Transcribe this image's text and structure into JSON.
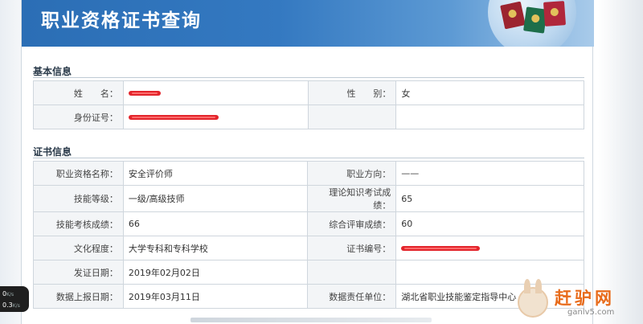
{
  "banner": {
    "title": "职业资格证书查询"
  },
  "basic": {
    "title": "基本信息",
    "rows": [
      {
        "l1": "姓　　名：",
        "v1": "",
        "l2": "性　　别：",
        "v2": "女"
      },
      {
        "l1": "身份证号：",
        "v1": "",
        "l2": "",
        "v2": ""
      }
    ]
  },
  "cert": {
    "title": "证书信息",
    "rows": [
      {
        "l1": "职业资格名称：",
        "v1": "安全评价师",
        "l2": "职业方向：",
        "v2": "——"
      },
      {
        "l1": "技能等级：",
        "v1": "一级/高级技师",
        "l2": "理论知识考试成绩：",
        "v2": "65"
      },
      {
        "l1": "技能考核成绩：",
        "v1": "66",
        "l2": "综合评审成绩：",
        "v2": "60"
      },
      {
        "l1": "文化程度：",
        "v1": "大学专科和专科学校",
        "l2": "证书编号：",
        "v2": ""
      },
      {
        "l1": "发证日期：",
        "v1": "2019年02月02日",
        "l2": "",
        "v2": ""
      },
      {
        "l1": "数据上报日期：",
        "v1": "2019年03月11日",
        "l2": "数据责任单位：",
        "v2": "湖北省职业技能鉴定指导中心"
      }
    ]
  },
  "network_widget": {
    "down_value": "0",
    "down_unit": "K/s",
    "up_value": "0.3",
    "up_unit": "K/s"
  },
  "watermark": {
    "text": "赶驴网",
    "url": "ganlv5.com"
  },
  "colors": {
    "banner": "#2b6eb5",
    "redaction": "#e3252c",
    "watermark": "#e86b1a"
  }
}
